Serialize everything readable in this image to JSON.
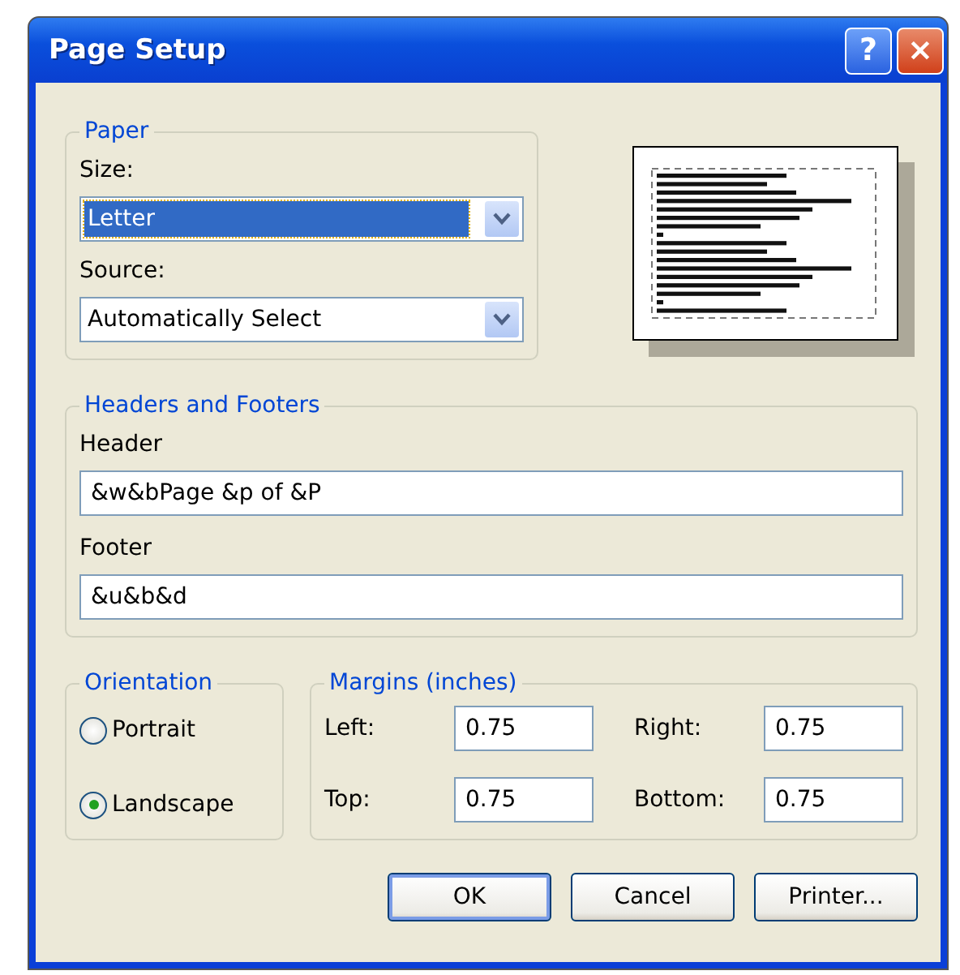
{
  "window": {
    "title": "Page Setup",
    "help_button": "?",
    "close_button": "×"
  },
  "paper": {
    "title": "Paper",
    "size_label": "Size:",
    "size_value": "Letter",
    "size_focused": true,
    "source_label": "Source:",
    "source_value": "Automatically Select"
  },
  "headers_footers": {
    "title": "Headers and Footers",
    "header_label": "Header",
    "header_value": "&w&bPage &p of &P",
    "footer_label": "Footer",
    "footer_value": "&u&b&d"
  },
  "orientation": {
    "title": "Orientation",
    "options": [
      {
        "label": "Portrait",
        "selected": false
      },
      {
        "label": "Landscape",
        "selected": true
      }
    ]
  },
  "margins": {
    "title": "Margins (inches)",
    "fields": [
      {
        "label": "Left:",
        "value": "0.75"
      },
      {
        "label": "Right:",
        "value": "0.75"
      },
      {
        "label": "Top:",
        "value": "0.75"
      },
      {
        "label": "Bottom:",
        "value": "0.75"
      }
    ]
  },
  "buttons": [
    {
      "label": "OK",
      "default": true
    },
    {
      "label": "Cancel",
      "default": false
    },
    {
      "label": "Printer...",
      "default": false
    }
  ]
}
